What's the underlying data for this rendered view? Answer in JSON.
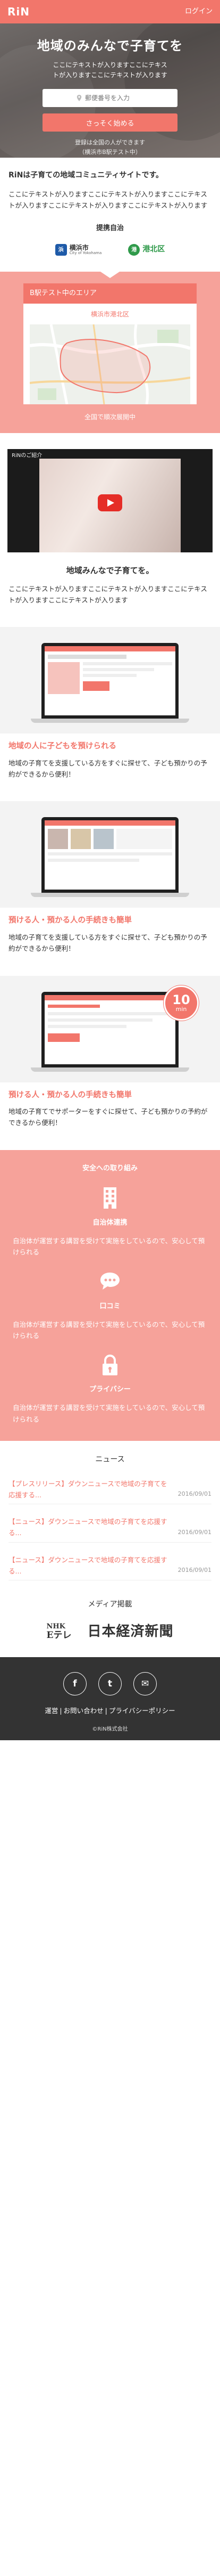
{
  "header": {
    "logo": "RiN",
    "login": "ログイン"
  },
  "hero": {
    "title": "地域のみんなで子育てを",
    "sub1": "ここにテキストが入りますここにテキス",
    "sub2": "トが入りますここにテキストが入ります",
    "zip_placeholder": "郵便番号を入力",
    "button": "さっそく始める",
    "note1": "登録は全国の人ができます",
    "note2": "（横浜市B駅テスト中）"
  },
  "intro": {
    "title": "RiNは子育ての地域コミュニティサイトです。",
    "text": "ここにテキストが入りますここにテキストが入りますここにテキストが入りますここにテキストが入りますここにテキストが入ります",
    "gov_title": "提携自治",
    "gov": [
      {
        "mark": "浜",
        "name": "横浜市",
        "sub": "City of Yokohama"
      },
      {
        "mark": "港",
        "name": "港北区"
      }
    ]
  },
  "area": {
    "head": "B駅テスト中のエリア",
    "sub": "横浜市港北区",
    "foot": "全国で順次展開中"
  },
  "video": {
    "bar": "RiNのご紹介"
  },
  "community": {
    "title": "地域みんなで子育てを。",
    "text": "ここにテキストが入りますここにテキストが入りますここにテキストが入りますここにテキストが入ります"
  },
  "features": [
    {
      "title": "地域の人に子どもを預けられる",
      "text": "地域の子育てを支援している方をすぐに探せて、子ども預かりの予約ができるから便利！"
    },
    {
      "title": "預ける人・預かる人の手続きも簡単",
      "text": "地域の子育てを支援している方をすぐに探せて、子ども預かりの予約ができるから便利！"
    },
    {
      "title": "預ける人・預かる人の手続きも簡単",
      "text": "地域の子育てでサポーターをすぐに探せて、子ども預かりの予約ができるから便利！",
      "badge_num": "10",
      "badge_unit": "min"
    }
  ],
  "safety": {
    "title": "安全への取り組み",
    "items": [
      {
        "label": "自治体連携",
        "text": "自治体が運営する講習を受けて実施をしているので、安心して預けられる"
      },
      {
        "label": "口コミ",
        "text": "自治体が運営する講習を受けて実施をしているので、安心して預けられる"
      },
      {
        "label": "プライバシー",
        "text": "自治体が運営する講習を受けて実施をしているので、安心して預けられる"
      }
    ]
  },
  "news": {
    "title": "ニュース",
    "items": [
      {
        "text": "【プレスリリース】ダウンニュースで地域の子育てを応援する...",
        "date": "2016/09/01"
      },
      {
        "text": "【ニュース】ダウンニュースで地域の子育てを応援する...",
        "date": "2016/09/01"
      },
      {
        "text": "【ニュース】ダウンニュースで地域の子育てを応援する...",
        "date": "2016/09/01"
      }
    ]
  },
  "media": {
    "title": "メディア掲載",
    "nhk_top": "NHK",
    "nhk_bottom": "Eテレ",
    "nikkei": "日本経済新聞"
  },
  "footer": {
    "socials": [
      "f",
      "t",
      "✉"
    ],
    "links": [
      "運営",
      "お問い合わせ",
      "プライバシーポリシー"
    ],
    "copyright": "©RiN株式会社"
  },
  "colors": {
    "accent": "#f2766b",
    "accent_light": "#f6a29a",
    "footer": "#333333"
  }
}
